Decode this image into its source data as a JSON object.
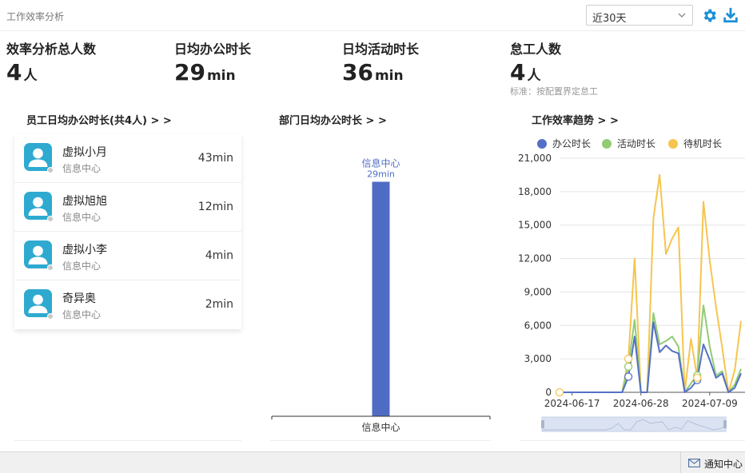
{
  "header": {
    "title": "工作效率分析",
    "period_select": "近30天"
  },
  "stats": [
    {
      "label": "效率分析总人数",
      "value": "4",
      "unit": "人"
    },
    {
      "label": "日均办公时长",
      "value": "29",
      "unit": "min"
    },
    {
      "label": "日均活动时长",
      "value": "36",
      "unit": "min"
    },
    {
      "label": "怠工人数",
      "value": "4",
      "unit": "人",
      "note": "标准：按配置界定怠工"
    }
  ],
  "employees": {
    "title": "员工日均办公时长(共4人) > >",
    "items": [
      {
        "name": "虚拟小月",
        "dept": "信息中心",
        "time": "43min"
      },
      {
        "name": "虚拟旭旭",
        "dept": "信息中心",
        "time": "12min"
      },
      {
        "name": "虚拟小李",
        "dept": "信息中心",
        "time": "4min"
      },
      {
        "name": "奇异奥",
        "dept": "信息中心",
        "time": "2min"
      }
    ]
  },
  "dept_chart": {
    "title": "部门日均办公时长 > >",
    "bar_label_name": "信息中心",
    "bar_label_value": "29min"
  },
  "trend_chart": {
    "title": "工作效率趋势 > >"
  },
  "chart_data": [
    {
      "type": "bar",
      "categories": [
        "信息中心"
      ],
      "values": [
        29
      ],
      "ylim": [
        0,
        33
      ],
      "color": "#4f6cc5"
    },
    {
      "type": "line",
      "legend": "top",
      "x_ticks": [
        "2024-06-17",
        "2024-06-28",
        "2024-07-09"
      ],
      "y_ticks": [
        "0",
        "3,000",
        "6,000",
        "9,000",
        "12,000",
        "15,000",
        "18,000",
        "21,000"
      ],
      "ylim": [
        0,
        21000
      ],
      "x": [
        "2024-06-15",
        "2024-06-16",
        "2024-06-17",
        "2024-06-18",
        "2024-06-19",
        "2024-06-20",
        "2024-06-21",
        "2024-06-22",
        "2024-06-23",
        "2024-06-24",
        "2024-06-25",
        "2024-06-26",
        "2024-06-27",
        "2024-06-28",
        "2024-06-29",
        "2024-06-30",
        "2024-07-01",
        "2024-07-02",
        "2024-07-03",
        "2024-07-04",
        "2024-07-05",
        "2024-07-06",
        "2024-07-07",
        "2024-07-08",
        "2024-07-09",
        "2024-07-10",
        "2024-07-11",
        "2024-07-12",
        "2024-07-13",
        "2024-07-14"
      ],
      "series": [
        {
          "name": "办公时长",
          "color": "#5470c6",
          "values": [
            0,
            0,
            0,
            0,
            0,
            0,
            0,
            0,
            0,
            0,
            0,
            1400,
            5000,
            0,
            0,
            6300,
            3600,
            4200,
            3700,
            3500,
            0,
            400,
            1100,
            4300,
            2900,
            1300,
            1700,
            0,
            400,
            1700
          ]
        },
        {
          "name": "活动时长",
          "color": "#91cc75",
          "values": [
            0,
            0,
            0,
            0,
            0,
            0,
            0,
            0,
            0,
            0,
            0,
            2300,
            6500,
            0,
            0,
            7100,
            4300,
            4600,
            5000,
            4100,
            0,
            800,
            1500,
            7800,
            4100,
            1500,
            1900,
            0,
            700,
            2100
          ]
        },
        {
          "name": "待机时长",
          "color": "#f5c54f",
          "values": [
            0,
            0,
            0,
            0,
            0,
            0,
            0,
            0,
            0,
            0,
            0,
            3000,
            12000,
            0,
            0,
            15600,
            19500,
            12400,
            13800,
            14800,
            0,
            4800,
            1300,
            17100,
            11800,
            7700,
            4000,
            0,
            2000,
            6400
          ]
        }
      ]
    }
  ],
  "footer": {
    "notice_label": "通知中心"
  }
}
